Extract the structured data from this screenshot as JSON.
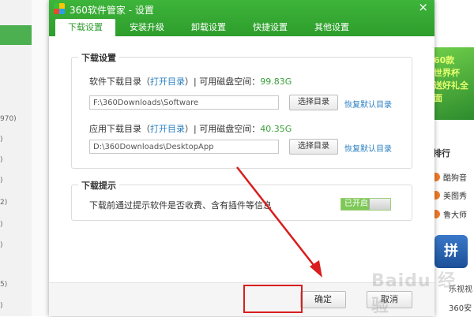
{
  "background": {
    "left_numbers": [
      "970)",
      ")",
      ")",
      ")",
      "2)",
      ")",
      ")",
      "5)",
      ")"
    ],
    "banner_text": [
      "60款",
      "世界杯",
      "送好礼全面"
    ],
    "rank_title": "排行",
    "rank_items": [
      "酷狗音",
      "美图秀",
      "鲁大师"
    ],
    "app_tile_label": "拼",
    "bottom_items": [
      "乐视视",
      "360安"
    ],
    "watermark": "Baidu 经验"
  },
  "dialog": {
    "title": "360软件管家 - 设置",
    "close_label": "×",
    "tabs": [
      {
        "label": "下载设置",
        "active": true
      },
      {
        "label": "安装升级",
        "active": false
      },
      {
        "label": "卸载设置",
        "active": false
      },
      {
        "label": "快捷设置",
        "active": false
      },
      {
        "label": "其他设置",
        "active": false
      }
    ],
    "download_group": {
      "title": "下载设置",
      "software": {
        "label": "软件下载目录（",
        "open_link": "打开目录",
        "mid": "）| 可用磁盘空间：",
        "space": "99.83G",
        "path": "F:\\360Downloads\\Software",
        "choose_button": "选择目录",
        "restore_link": "恢复默认目录"
      },
      "apps": {
        "label": "应用下载目录（",
        "open_link": "打开目录",
        "mid": "）| 可用磁盘空间：",
        "space": "40.35G",
        "path": "D:\\360Downloads\\DesktopApp",
        "choose_button": "选择目录",
        "restore_link": "恢复默认目录"
      }
    },
    "tips_group": {
      "title": "下载提示",
      "text": "下载前通过提示软件是否收费、含有插件等信息",
      "toggle_label": "已开启",
      "toggle_on": true
    },
    "footer": {
      "ok_button": "确定",
      "cancel_button": "取消"
    }
  },
  "colors": {
    "titlebar": "#2e9d2c",
    "link": "#2a7fc2",
    "space": "#3aa03a",
    "highlight": "#d81e1e",
    "arrow": "#d81e1e"
  }
}
